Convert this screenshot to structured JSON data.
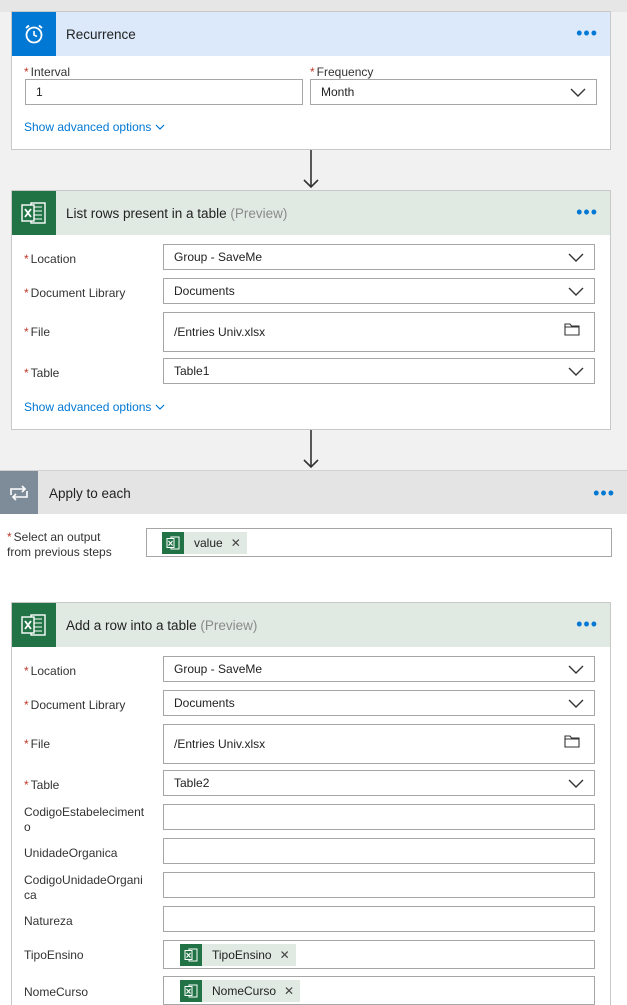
{
  "recurrence": {
    "title": "Recurrence",
    "icon": "alarm-clock-icon",
    "interval_label": "Interval",
    "interval_value": "1",
    "frequency_label": "Frequency",
    "frequency_value": "Month",
    "advanced": "Show advanced options"
  },
  "list_rows": {
    "title": "List rows present in a table",
    "preview": "(Preview)",
    "icon": "excel-icon",
    "location_label": "Location",
    "location_value": "Group - SaveMe",
    "library_label": "Document Library",
    "library_value": "Documents",
    "file_label": "File",
    "file_value": "/Entries Univ.xlsx",
    "table_label": "Table",
    "table_value": "Table1",
    "advanced": "Show advanced options"
  },
  "apply_each": {
    "title": "Apply to each",
    "select_label_1": "Select an output",
    "select_label_2": "from previous steps",
    "token": "value"
  },
  "add_row": {
    "title": "Add a row into a table",
    "preview": "(Preview)",
    "location_label": "Location",
    "location_value": "Group - SaveMe",
    "library_label": "Document Library",
    "library_value": "Documents",
    "file_label": "File",
    "file_value": "/Entries Univ.xlsx",
    "table_label": "Table",
    "table_value": "Table2",
    "codigo_est_1": "CodigoEstabeleciment",
    "codigo_est_2": "o",
    "unidade": "UnidadeOrganica",
    "codigo_uni_1": "CodigoUnidadeOrgani",
    "codigo_uni_2": "ca",
    "natureza": "Natureza",
    "tipo_label": "TipoEnsino",
    "tipo_token": "TipoEnsino",
    "nome_label": "NomeCurso",
    "nome_token": "NomeCurso"
  },
  "colors": {
    "accent": "#0078d4",
    "excel_green": "#217346",
    "required": "#c0392b"
  }
}
